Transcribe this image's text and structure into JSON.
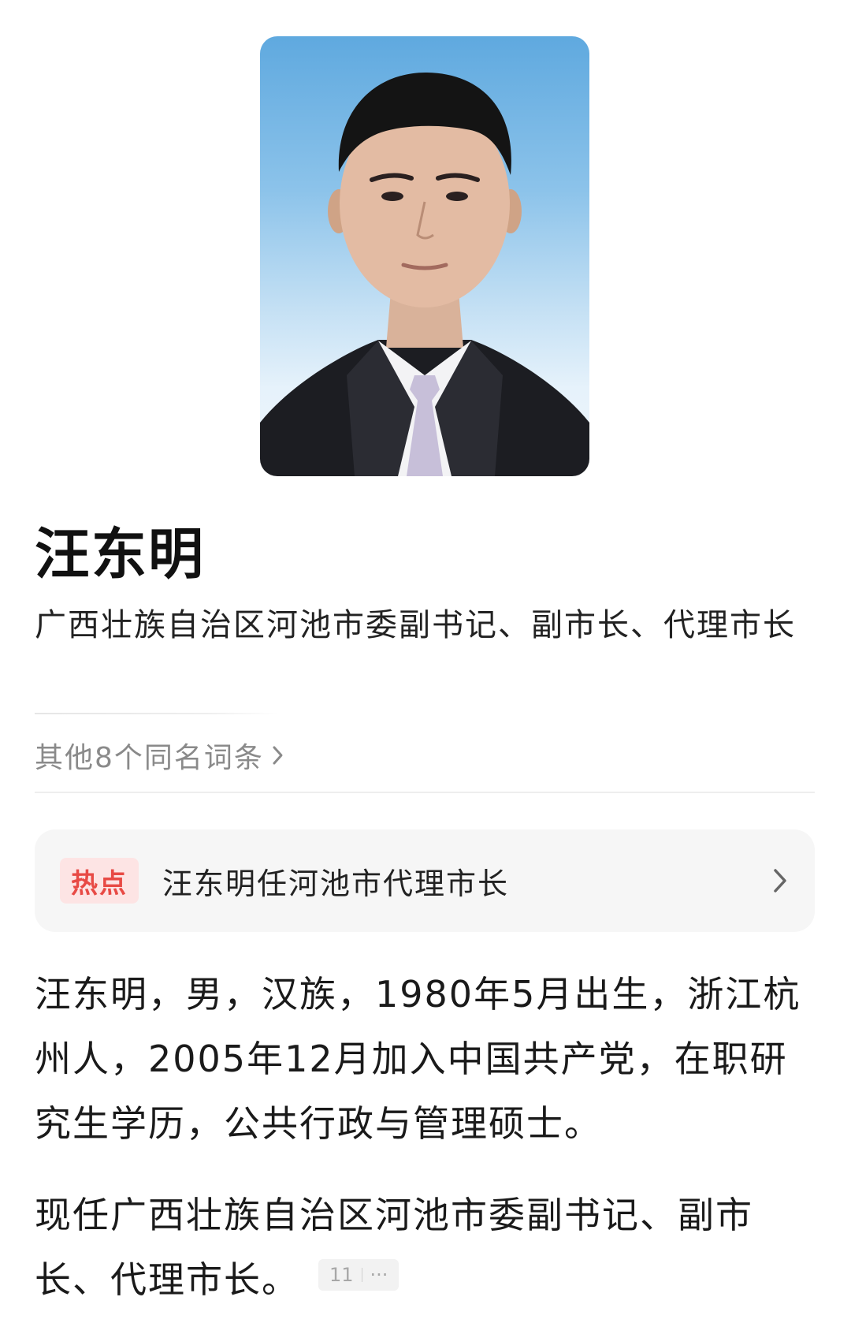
{
  "header": {
    "portrait_alt": "汪东明"
  },
  "title": "汪东明",
  "subtitle": "广西壮族自治区河池市委副书记、副市长、代理市长",
  "other_entries": {
    "label": "其他8个同名词条"
  },
  "hot": {
    "badge": "热点",
    "text": "汪东明任河池市代理市长"
  },
  "bio": "汪东明，男，汉族，1980年5月出生，浙江杭州人，2005年12月加入中国共产党，在职研究生学历，公共行政与管理硕士。",
  "position": {
    "text": "现任广西壮族自治区河池市委副书记、副市长、代理市长。",
    "ref_count": "11",
    "ref_more": "···"
  },
  "colors": {
    "hot_badge_bg": "#fde4e4",
    "hot_badge_text": "#e84a45",
    "muted_text": "#8a8a8a",
    "card_bg": "#f6f6f6"
  },
  "icons": {
    "other_entries": "chevron-right-icon",
    "hot_card": "chevron-right-icon",
    "ref_badge": "more-icon"
  }
}
